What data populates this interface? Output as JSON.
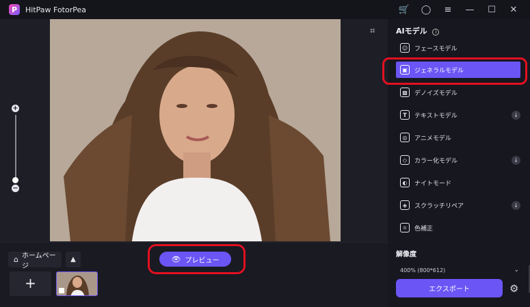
{
  "window": {
    "title": "HitPaw FotorPea",
    "logo_letter": "P",
    "icons": [
      "cart-icon",
      "account-icon",
      "menu-icon",
      "minimize-icon",
      "maximize-icon",
      "close-icon"
    ]
  },
  "canvas": {
    "zoom_plus": "+",
    "zoom_minus": "−"
  },
  "bottom": {
    "home_label": "ホームページ",
    "collapse_glyph": "▲",
    "preview_label": "プレビュー",
    "add_glyph": "+"
  },
  "sidebar": {
    "title": "AIモデル",
    "info_glyph": "i",
    "models": [
      {
        "label": "フェースモデル",
        "icon": "face-icon",
        "glyph": "☺",
        "download": false,
        "selected": false
      },
      {
        "label": "ジェネラルモデル",
        "icon": "image-icon",
        "glyph": "▣",
        "download": false,
        "selected": true
      },
      {
        "label": "デノイズモデル",
        "icon": "denoise-icon",
        "glyph": "▩",
        "download": false,
        "selected": false
      },
      {
        "label": "テキストモデル",
        "icon": "text-icon",
        "glyph": "T",
        "download": true,
        "selected": false
      },
      {
        "label": "アニメモデル",
        "icon": "anime-icon",
        "glyph": "◎",
        "download": false,
        "selected": false
      },
      {
        "label": "カラー化モデル",
        "icon": "colorize-icon",
        "glyph": "◇",
        "download": true,
        "selected": false
      },
      {
        "label": "ナイトモード",
        "icon": "night-icon",
        "glyph": "◐",
        "download": false,
        "selected": false
      },
      {
        "label": "スクラッチリペア",
        "icon": "scratch-icon",
        "glyph": "◈",
        "download": true,
        "selected": false
      },
      {
        "label": "色補正",
        "icon": "color-correct-icon",
        "glyph": "☼",
        "download": false,
        "selected": false
      }
    ],
    "download_glyph": "↓",
    "resolution_title": "解像度",
    "resolution_value": "400% (800*612)",
    "export_label": "エクスポート"
  }
}
